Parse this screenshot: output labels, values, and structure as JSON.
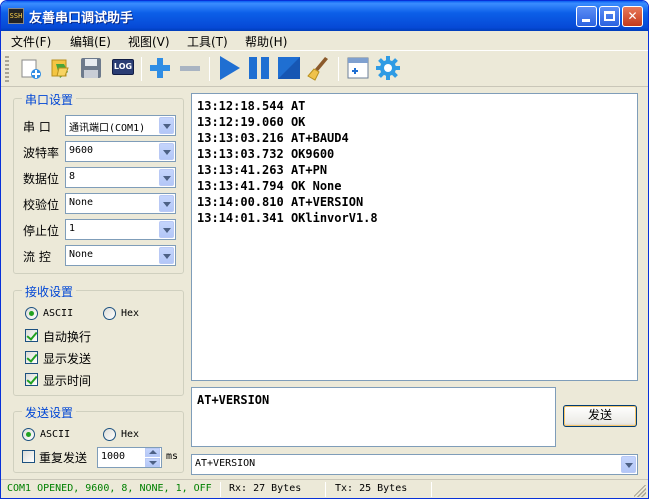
{
  "window": {
    "title": "友善串口调试助手",
    "app_icon_text": "SSH"
  },
  "menu": [
    {
      "label": "文件(F)"
    },
    {
      "label": "编辑(E)"
    },
    {
      "label": "视图(V)"
    },
    {
      "label": "工具(T)"
    },
    {
      "label": "帮助(H)"
    }
  ],
  "toolbar": {
    "icons": [
      "new-icon",
      "open-icon",
      "save-icon",
      "log-icon",
      "add-icon",
      "remove-icon",
      "play-icon",
      "pause-icon",
      "stop-icon",
      "clear-icon",
      "window-icon",
      "settings-icon"
    ],
    "log_text": "LOG"
  },
  "serial": {
    "title": "串口设置",
    "port_label": "串  口",
    "port_value": "通讯端口(COM1)",
    "baud_label": "波特率",
    "baud_value": "9600",
    "databits_label": "数据位",
    "databits_value": "8",
    "parity_label": "校验位",
    "parity_value": "None",
    "stopbits_label": "停止位",
    "stopbits_value": "1",
    "flow_label": "流  控",
    "flow_value": "None"
  },
  "receive": {
    "title": "接收设置",
    "ascii_label": "ASCII",
    "hex_label": "Hex",
    "mode": "ASCII",
    "auto_wrap_label": "自动换行",
    "auto_wrap": true,
    "show_send_label": "显示发送",
    "show_send": true,
    "show_time_label": "显示时间",
    "show_time": true
  },
  "send": {
    "title": "发送设置",
    "ascii_label": "ASCII",
    "hex_label": "Hex",
    "mode": "ASCII",
    "repeat_label": "重复发送",
    "repeat": false,
    "interval_value": "1000",
    "interval_unit": "ms"
  },
  "log": [
    {
      "time": "13:12:18.544",
      "text": "AT"
    },
    {
      "time": "13:12:19.060",
      "text": "OK"
    },
    {
      "time": "13:13:03.216",
      "text": "AT+BAUD4"
    },
    {
      "time": "13:13:03.732",
      "text": "OK9600"
    },
    {
      "time": "13:13:41.263",
      "text": "AT+PN"
    },
    {
      "time": "13:13:41.794",
      "text": "OK None"
    },
    {
      "time": "13:14:00.810",
      "text": "AT+VERSION"
    },
    {
      "time": "13:14:01.341",
      "text": "OKlinvorV1.8"
    }
  ],
  "send_input": {
    "value": "AT+VERSION"
  },
  "send_button": {
    "label": "发送"
  },
  "history": {
    "selected": "AT+VERSION"
  },
  "status": {
    "connection": "COM1 OPENED, 9600, 8, NONE, 1, OFF",
    "connection_color": "#008000",
    "rx": "Rx: 27 Bytes",
    "tx": "Tx: 25 Bytes"
  }
}
